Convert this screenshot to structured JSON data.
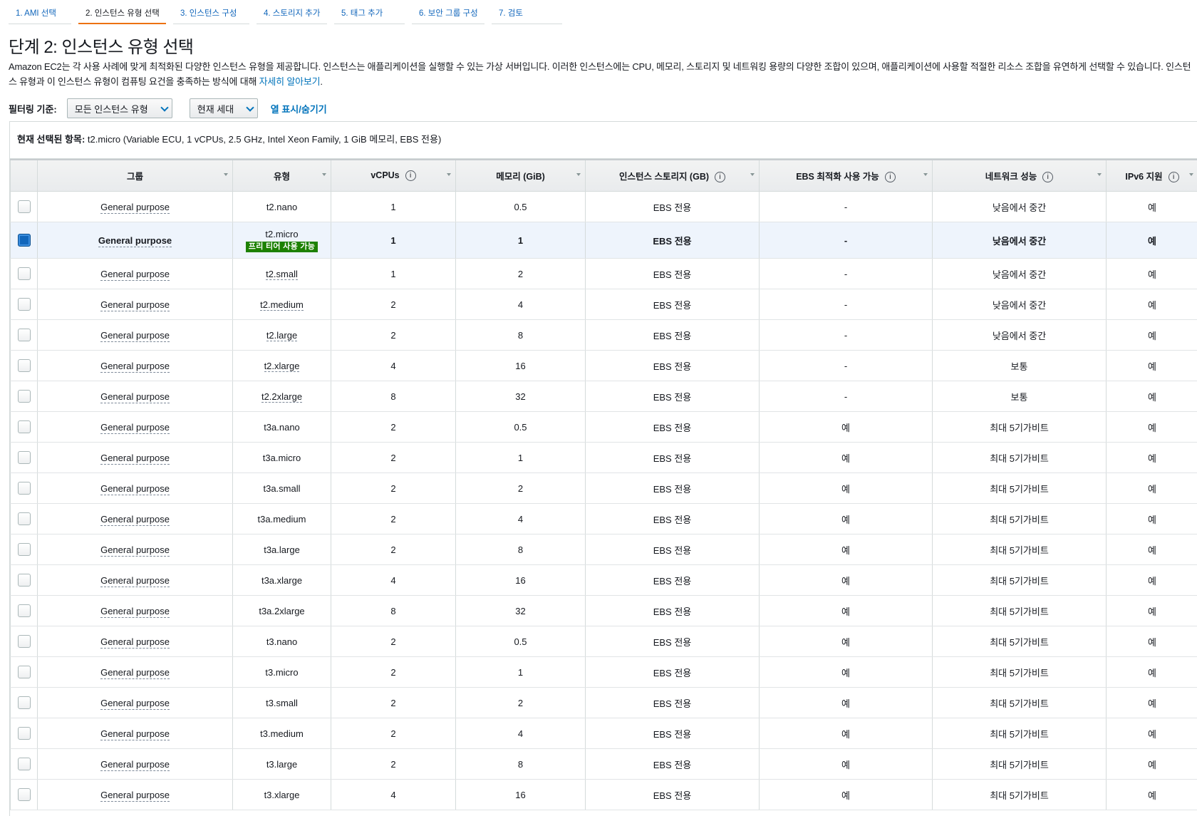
{
  "wizard": {
    "steps": [
      "1. AMI 선택",
      "2. 인스턴스 유형 선택",
      "3. 인스턴스 구성",
      "4. 스토리지 추가",
      "5. 태그 추가",
      "6. 보안 그룹 구성",
      "7. 검토"
    ],
    "active_index": 1
  },
  "page": {
    "title": "단계 2: 인스턴스 유형 선택",
    "description": "Amazon EC2는 각 사용 사례에 맞게 최적화된 다양한 인스턴스 유형을 제공합니다. 인스턴스는 애플리케이션을 실행할 수 있는 가상 서버입니다. 이러한 인스턴스에는 CPU, 메모리, 스토리지 및 네트워킹 용량의 다양한 조합이 있으며, 애플리케이션에 사용할 적절한 리소스 조합을 유연하게 선택할 수 있습니다. 인스턴스 유형과 이 인스턴스 유형이 컴퓨팅 요건을 충족하는 방식에 대해 ",
    "learn_more": "자세히 알아보기",
    "description_end": "."
  },
  "filter": {
    "label": "필터링 기준:",
    "type_select": "모든 인스턴스 유형",
    "generation_select": "현재 세대",
    "columns_button": "열 표시/숨기기"
  },
  "current_selection": {
    "label": "현재 선택된 항목:",
    "value": " t2.micro (Variable ECU, 1 vCPUs, 2.5 GHz, Intel Xeon Family, 1 GiB 메모리, EBS 전용)"
  },
  "table": {
    "headers": {
      "group": "그룹",
      "type": "유형",
      "vcpus": "vCPUs",
      "memory": "메모리 (GiB)",
      "storage": "인스턴스 스토리지 (GB)",
      "ebs": "EBS 최적화 사용 가능",
      "network": "네트워크 성능",
      "ipv6": "IPv6 지원"
    },
    "free_tier_badge": "프리 티어 사용 가능",
    "rows": [
      {
        "group": "General purpose",
        "type": "t2.nano",
        "vcpus": "1",
        "memory": "0.5",
        "storage": "EBS 전용",
        "ebs": "-",
        "network": "낮음에서 중간",
        "ipv6": "예",
        "selected": false
      },
      {
        "group": "General purpose",
        "type": "t2.micro",
        "vcpus": "1",
        "memory": "1",
        "storage": "EBS 전용",
        "ebs": "-",
        "network": "낮음에서 중간",
        "ipv6": "예",
        "selected": true
      },
      {
        "group": "General purpose",
        "type": "t2.small",
        "vcpus": "1",
        "memory": "2",
        "storage": "EBS 전용",
        "ebs": "-",
        "network": "낮음에서 중간",
        "ipv6": "예",
        "selected": false
      },
      {
        "group": "General purpose",
        "type": "t2.medium",
        "vcpus": "2",
        "memory": "4",
        "storage": "EBS 전용",
        "ebs": "-",
        "network": "낮음에서 중간",
        "ipv6": "예",
        "selected": false
      },
      {
        "group": "General purpose",
        "type": "t2.large",
        "vcpus": "2",
        "memory": "8",
        "storage": "EBS 전용",
        "ebs": "-",
        "network": "낮음에서 중간",
        "ipv6": "예",
        "selected": false
      },
      {
        "group": "General purpose",
        "type": "t2.xlarge",
        "vcpus": "4",
        "memory": "16",
        "storage": "EBS 전용",
        "ebs": "-",
        "network": "보통",
        "ipv6": "예",
        "selected": false
      },
      {
        "group": "General purpose",
        "type": "t2.2xlarge",
        "vcpus": "8",
        "memory": "32",
        "storage": "EBS 전용",
        "ebs": "-",
        "network": "보통",
        "ipv6": "예",
        "selected": false
      },
      {
        "group": "General purpose",
        "type": "t3a.nano",
        "vcpus": "2",
        "memory": "0.5",
        "storage": "EBS 전용",
        "ebs": "예",
        "network": "최대 5기가비트",
        "ipv6": "예",
        "selected": false
      },
      {
        "group": "General purpose",
        "type": "t3a.micro",
        "vcpus": "2",
        "memory": "1",
        "storage": "EBS 전용",
        "ebs": "예",
        "network": "최대 5기가비트",
        "ipv6": "예",
        "selected": false
      },
      {
        "group": "General purpose",
        "type": "t3a.small",
        "vcpus": "2",
        "memory": "2",
        "storage": "EBS 전용",
        "ebs": "예",
        "network": "최대 5기가비트",
        "ipv6": "예",
        "selected": false
      },
      {
        "group": "General purpose",
        "type": "t3a.medium",
        "vcpus": "2",
        "memory": "4",
        "storage": "EBS 전용",
        "ebs": "예",
        "network": "최대 5기가비트",
        "ipv6": "예",
        "selected": false
      },
      {
        "group": "General purpose",
        "type": "t3a.large",
        "vcpus": "2",
        "memory": "8",
        "storage": "EBS 전용",
        "ebs": "예",
        "network": "최대 5기가비트",
        "ipv6": "예",
        "selected": false
      },
      {
        "group": "General purpose",
        "type": "t3a.xlarge",
        "vcpus": "4",
        "memory": "16",
        "storage": "EBS 전용",
        "ebs": "예",
        "network": "최대 5기가비트",
        "ipv6": "예",
        "selected": false
      },
      {
        "group": "General purpose",
        "type": "t3a.2xlarge",
        "vcpus": "8",
        "memory": "32",
        "storage": "EBS 전용",
        "ebs": "예",
        "network": "최대 5기가비트",
        "ipv6": "예",
        "selected": false
      },
      {
        "group": "General purpose",
        "type": "t3.nano",
        "vcpus": "2",
        "memory": "0.5",
        "storage": "EBS 전용",
        "ebs": "예",
        "network": "최대 5기가비트",
        "ipv6": "예",
        "selected": false
      },
      {
        "group": "General purpose",
        "type": "t3.micro",
        "vcpus": "2",
        "memory": "1",
        "storage": "EBS 전용",
        "ebs": "예",
        "network": "최대 5기가비트",
        "ipv6": "예",
        "selected": false
      },
      {
        "group": "General purpose",
        "type": "t3.small",
        "vcpus": "2",
        "memory": "2",
        "storage": "EBS 전용",
        "ebs": "예",
        "network": "최대 5기가비트",
        "ipv6": "예",
        "selected": false
      },
      {
        "group": "General purpose",
        "type": "t3.medium",
        "vcpus": "2",
        "memory": "4",
        "storage": "EBS 전용",
        "ebs": "예",
        "network": "최대 5기가비트",
        "ipv6": "예",
        "selected": false
      },
      {
        "group": "General purpose",
        "type": "t3.large",
        "vcpus": "2",
        "memory": "8",
        "storage": "EBS 전용",
        "ebs": "예",
        "network": "최대 5기가비트",
        "ipv6": "예",
        "selected": false
      },
      {
        "group": "General purpose",
        "type": "t3.xlarge",
        "vcpus": "4",
        "memory": "16",
        "storage": "EBS 전용",
        "ebs": "예",
        "network": "최대 5기가비트",
        "ipv6": "예",
        "selected": false
      }
    ]
  }
}
